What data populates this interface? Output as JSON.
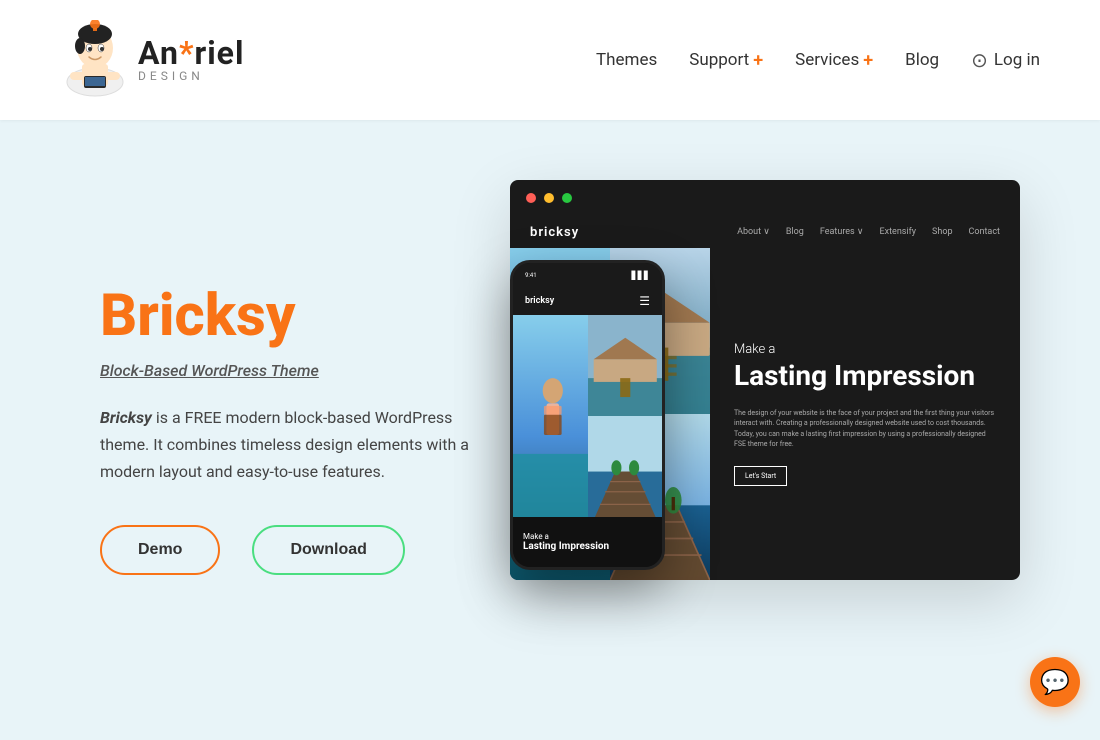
{
  "header": {
    "logo": {
      "brand": "Anariel",
      "brand_asterisk": "*",
      "sub": "DESIGN"
    },
    "nav": {
      "items": [
        {
          "label": "Themes",
          "has_plus": false
        },
        {
          "label": "Support",
          "has_plus": true
        },
        {
          "label": "Services",
          "has_plus": true
        },
        {
          "label": "Blog",
          "has_plus": false
        }
      ],
      "login_label": "Log in"
    }
  },
  "hero": {
    "title": "Bricksy",
    "subtitle": "Block-Based WordPress Theme",
    "description_bold": "Bricksy",
    "description_rest": " is a FREE modern block-based WordPress theme. It combines timeless design elements with a modern layout and easy-to-use features.",
    "btn_demo": "Demo",
    "btn_download": "Download"
  },
  "desktop_mockup": {
    "logo": "bricksy",
    "nav_links": [
      "About +",
      "Blog",
      "Features +",
      "Extensify",
      "Shop",
      "Contact"
    ],
    "heading_small": "Make a",
    "heading_large": "Lasting Impression",
    "body_text": "The design of your website is the face of your project and the first thing your visitors interact with. Creating a professionally designed website used to cost thousands. Today, you can make a lasting first impression by using a professionally designed FSE theme for free.",
    "cta": "Let's Start"
  },
  "mobile_mockup": {
    "logo": "bricksy",
    "footer_make": "Make a",
    "footer_lasting": "Lasting",
    "footer_impression": "Impression"
  },
  "chat": {
    "icon": "💬"
  }
}
